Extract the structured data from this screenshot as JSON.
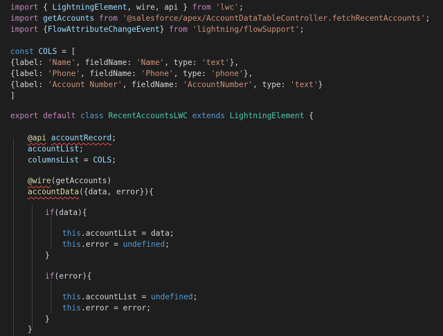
{
  "code": {
    "line1": {
      "kw_import": "import",
      "brace_open": "{ ",
      "name": "LightningElement",
      "rest": ", wire, api } ",
      "kw_from": "from",
      "str": "'lwc'",
      "semi": ";"
    },
    "line2": {
      "kw_import": "import",
      "name": "getAccounts",
      "kw_from": "from",
      "str": "'@salesforce/apex/AccountDataTableController.fetchRecentAccounts'",
      "semi": ";"
    },
    "line3": {
      "kw_import": "import",
      "brace_open": "{",
      "name": "FlowAttributeChangeEvent",
      "brace_close": "} ",
      "kw_from": "from",
      "str": "'lightning/flowSupport'",
      "semi": ";"
    },
    "line5": {
      "kw_const": "const",
      "name": "COLS",
      "rest": " = ["
    },
    "line6": {
      "p1": "{label: ",
      "s1": "'Name'",
      "p2": ", fieldName: ",
      "s2": "'Name'",
      "p3": ", type: ",
      "s3": "'text'",
      "p4": "},"
    },
    "line7": {
      "p1": "{label: ",
      "s1": "'Phone'",
      "p2": ", fieldName: ",
      "s2": "'Phone'",
      "p3": ", type: ",
      "s3": "'phone'",
      "p4": "},"
    },
    "line8": {
      "p1": "{label: ",
      "s1": "'Account Number'",
      "p2": ", fieldName: ",
      "s2": "'AccountNumber'",
      "p3": ", type: ",
      "s3": "'text'",
      "p4": "}"
    },
    "line9": {
      "text": "]"
    },
    "line11": {
      "kw_export": "export",
      "kw_default": "default",
      "kw_class": "class",
      "name": "RecentAccountsLWC",
      "kw_extends": "extends",
      "parent": "LightningElement",
      "brace": " {"
    },
    "line13": {
      "at": "@",
      "dec": "api",
      "name": "accountRecord",
      "semi": ";"
    },
    "line14": {
      "text": "accountList;"
    },
    "line15": {
      "name": "columnsList",
      "eq": " = ",
      "val": "COLS",
      "semi": ";"
    },
    "line17": {
      "at": "@",
      "dec": "wire",
      "arg": "(getAccounts)"
    },
    "line18": {
      "name": "accountData",
      "rest": "({data, error}){"
    },
    "line20": {
      "kw_if": "if",
      "rest": "(data){"
    },
    "line22": {
      "kw_this": "this",
      "prop": ".accountList = data;"
    },
    "line23": {
      "kw_this": "this",
      "prop": ".error = ",
      "val": "undefined",
      "semi": ";"
    },
    "line24": {
      "text": "}"
    },
    "line26": {
      "kw_if": "if",
      "rest": "(error){"
    },
    "line28": {
      "kw_this": "this",
      "prop": ".accountList = ",
      "val": "undefined",
      "semi": ";"
    },
    "line29": {
      "kw_this": "this",
      "prop": ".error = error;"
    },
    "line30": {
      "text": "}"
    },
    "line31": {
      "text": "}"
    }
  }
}
